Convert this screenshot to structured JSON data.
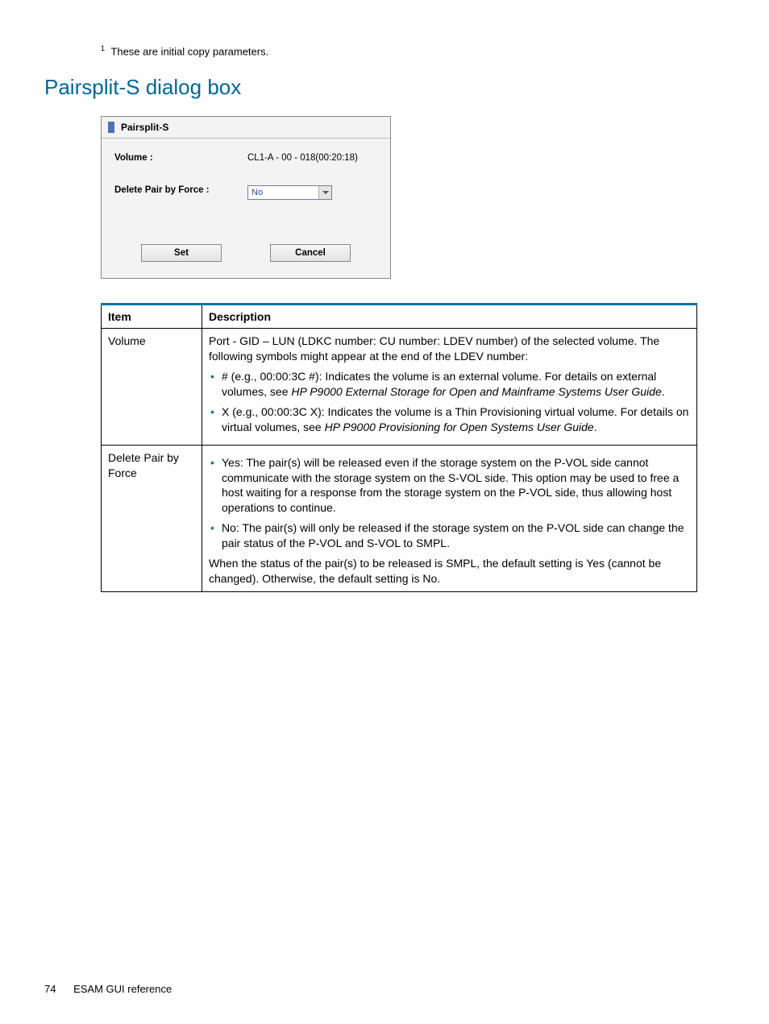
{
  "footnote": {
    "num": "1",
    "text": "These are initial copy parameters."
  },
  "section_title": "Pairsplit-S dialog box",
  "dialog": {
    "title": "Pairsplit-S",
    "volume_label": "Volume :",
    "volume_value": "CL1-A - 00 - 018(00:20:18)",
    "delete_label": "Delete Pair by Force :",
    "delete_value": "No",
    "set_btn": "Set",
    "cancel_btn": "Cancel"
  },
  "table": {
    "headers": {
      "item": "Item",
      "desc": "Description"
    },
    "rows": [
      {
        "item": "Volume",
        "intro": "Port - GID – LUN (LDKC number: CU number: LDEV number) of the selected volume. The following symbols might appear at the end of the LDEV number:",
        "bullets": [
          {
            "lead": "# (e.g., 00:00:3C #): Indicates the volume is an external volume. For details on external volumes, see ",
            "italic": "HP P9000 External Storage for Open and Mainframe Systems User Guide",
            "tail": "."
          },
          {
            "lead": "X (e.g., 00:00:3C X): Indicates the volume is a Thin Provisioning virtual volume. For details on virtual volumes, see ",
            "italic": "HP P9000 Provisioning for Open Systems User Guide",
            "tail": "."
          }
        ]
      },
      {
        "item": "Delete Pair by Force",
        "bullets_plain": [
          "Yes: The pair(s) will be released even if the storage system on the P-VOL side cannot communicate with the storage system on the S-VOL side. This option may be used to free a host waiting for a response from the storage system on the P-VOL side, thus allowing host operations to continue.",
          "No: The pair(s) will only be released if the storage system on the P-VOL side can change the pair status of the P-VOL and S-VOL to SMPL."
        ],
        "trail": "When the status of the pair(s) to be released is SMPL, the default setting is Yes (cannot be changed). Otherwise, the default setting is No."
      }
    ]
  },
  "footer": {
    "page": "74",
    "chapter": "ESAM GUI reference"
  }
}
